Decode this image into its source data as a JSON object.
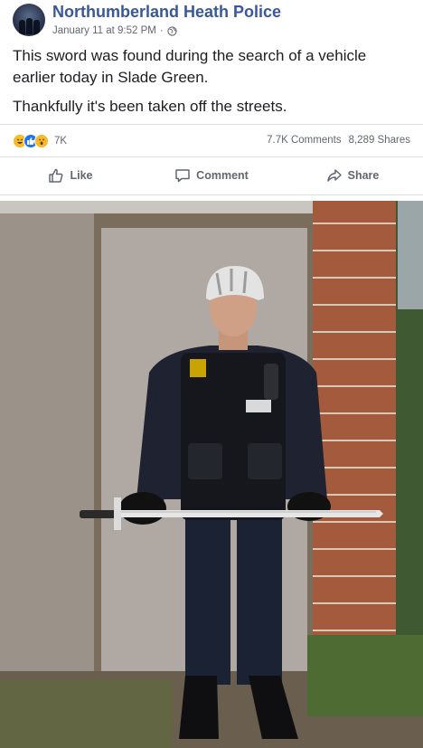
{
  "post": {
    "page_name": "Northumberland Heath Police",
    "timestamp": "January 11 at 9:52 PM",
    "separator": "·",
    "text_line1": "This sword was found during the search of a vehicle earlier today in Slade Green.",
    "text_line2": "Thankfully it's been taken off the streets."
  },
  "stats": {
    "reaction_icons": [
      "haha-icon",
      "like-icon",
      "wow-icon"
    ],
    "reaction_count": "7K",
    "comments": "7.7K Comments",
    "shares": "8,289 Shares"
  },
  "actions": {
    "like_label": "Like",
    "comment_label": "Comment",
    "share_label": "Share"
  },
  "colors": {
    "page_name": "#385898",
    "secondary_text": "#616770",
    "like_blue": "#1877f2",
    "reaction_yellow": "#f7b928",
    "divider": "#dadde1"
  }
}
